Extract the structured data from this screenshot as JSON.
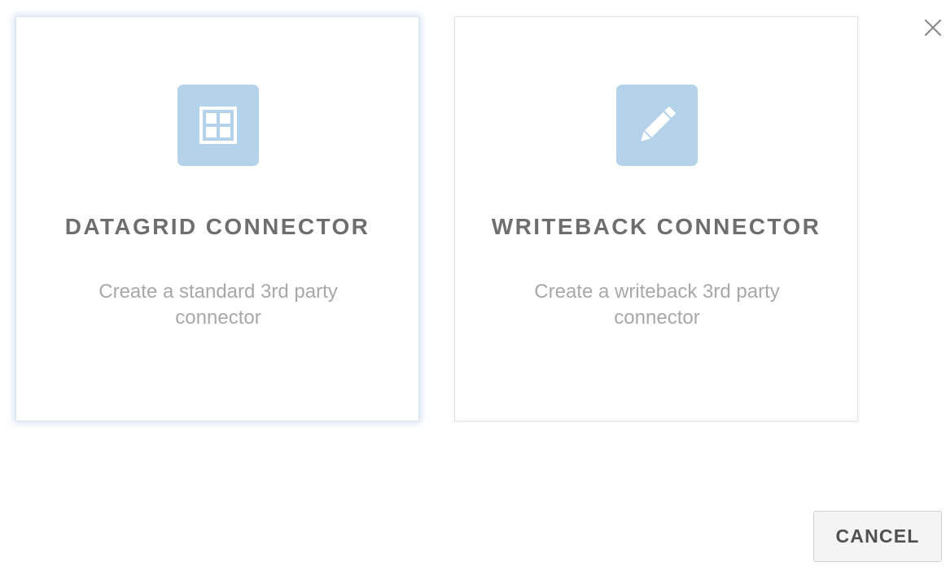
{
  "colors": {
    "icon_tile": "#b4d2ea",
    "icon_glyph": "#ffffff",
    "title_text": "#6e6e6e",
    "desc_text": "#a8a8a8",
    "selected_glow": "#78aadc"
  },
  "cards": [
    {
      "icon": "grid-icon",
      "title": "DATAGRID CONNECTOR",
      "description": "Create a standard 3rd party connector",
      "selected": true
    },
    {
      "icon": "pencil-icon",
      "title": "WRITEBACK CONNECTOR",
      "description": "Create a writeback 3rd party connector",
      "selected": false
    }
  ],
  "dialog": {
    "close_icon": "close-icon",
    "cancel_label": "CANCEL"
  }
}
